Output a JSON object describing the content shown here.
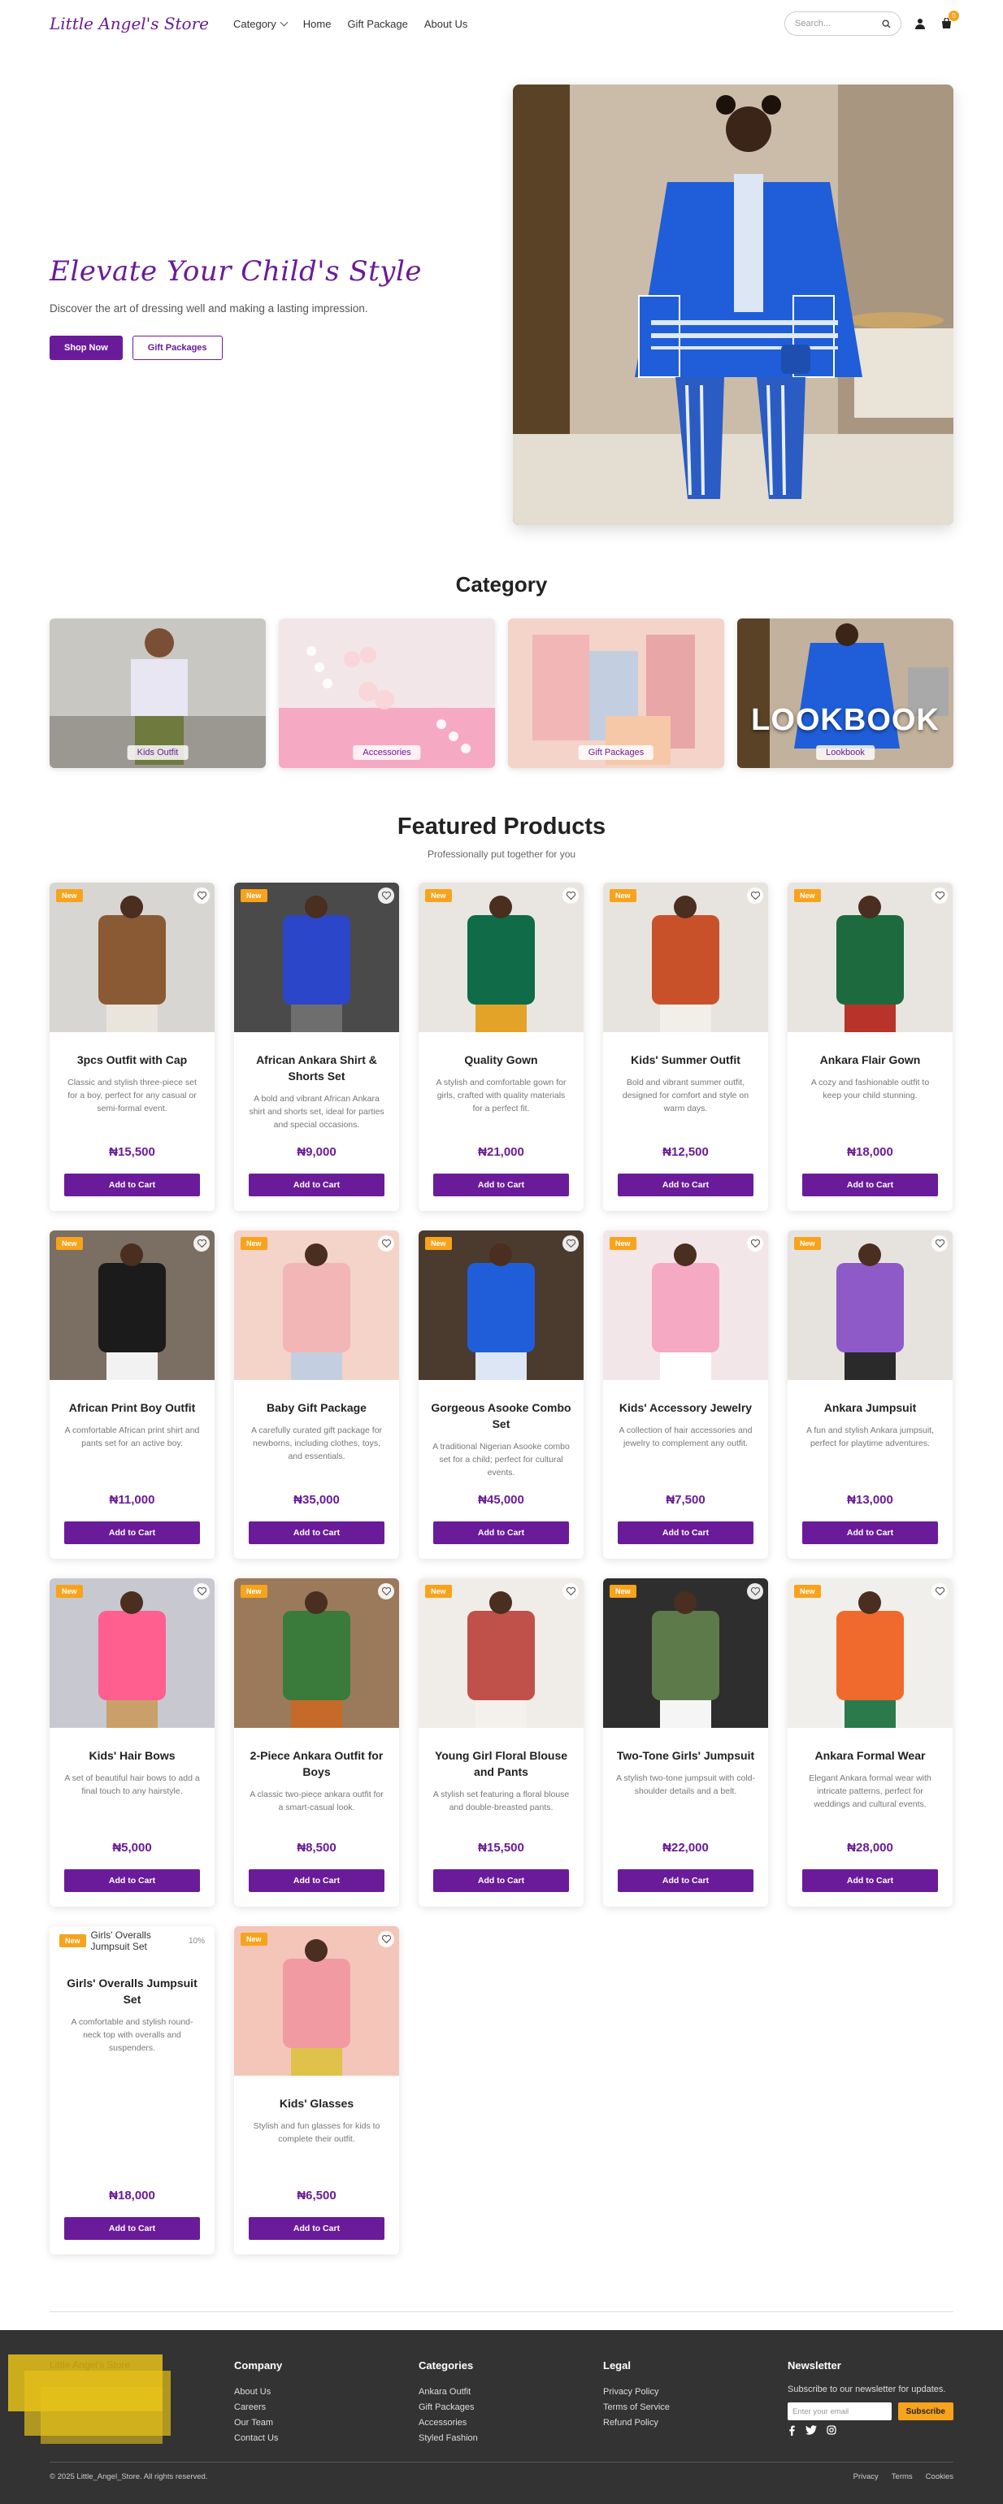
{
  "header": {
    "logo": "Little Angel's Store",
    "nav": [
      "Category",
      "Home",
      "Gift Package",
      "About Us"
    ],
    "search_placeholder": "Search...",
    "cart_count": "0"
  },
  "hero": {
    "title": "Elevate Your Child's Style",
    "subtitle": "Discover the art of dressing well and making a lasting impression.",
    "primary_button": "Shop Now",
    "secondary_button": "Gift Packages"
  },
  "category": {
    "title": "Category",
    "items": [
      {
        "label": "Kids Outfit"
      },
      {
        "label": "Accessories"
      },
      {
        "label": "Gift Packages"
      },
      {
        "label": "Lookbook",
        "overlay": "LOOKBOOK"
      }
    ]
  },
  "featured": {
    "title": "Featured Products",
    "subtitle": "Professionally put together for you",
    "badge": "New",
    "add_to_cart": "Add to Cart",
    "products": [
      {
        "name": "3pcs Outfit with Cap",
        "desc": "Classic and stylish three-piece set for a boy, perfect for any casual or semi-formal event.",
        "price": "₦15,500"
      },
      {
        "name": "African Ankara Shirt & Shorts Set",
        "desc": "A bold and vibrant African Ankara shirt and shorts set, ideal for parties and special occasions.",
        "price": "₦9,000"
      },
      {
        "name": "Quality Gown",
        "desc": "A stylish and comfortable gown for girls, crafted with quality materials for a perfect fit.",
        "price": "₦21,000"
      },
      {
        "name": "Kids' Summer Outfit",
        "desc": "Bold and vibrant summer outfit, designed for comfort and style on warm days.",
        "price": "₦12,500"
      },
      {
        "name": "Ankara Flair Gown",
        "desc": "A cozy and fashionable outfit to keep your child stunning.",
        "price": "₦18,000"
      },
      {
        "name": "African Print Boy Outfit",
        "desc": "A comfortable African print shirt and pants set for an active boy.",
        "price": "₦11,000"
      },
      {
        "name": "Baby Gift Package",
        "desc": "A carefully curated gift package for newborns, including clothes, toys, and essentials.",
        "price": "₦35,000"
      },
      {
        "name": "Gorgeous Asooke Combo Set",
        "desc": "A traditional Nigerian Asooke combo set for a child; perfect for cultural events.",
        "price": "₦45,000"
      },
      {
        "name": "Kids' Accessory Jewelry",
        "desc": "A collection of hair accessories and jewelry to complement any outfit.",
        "price": "₦7,500"
      },
      {
        "name": "Ankara Jumpsuit",
        "desc": "A fun and stylish Ankara jumpsuit, perfect for playtime adventures.",
        "price": "₦13,000"
      },
      {
        "name": "Kids' Hair Bows",
        "desc": "A set of beautiful hair bows to add a final touch to any hairstyle.",
        "price": "₦5,000"
      },
      {
        "name": "2-Piece Ankara Outfit for Boys",
        "desc": "A classic two-piece ankara outfit for a smart-casual look.",
        "price": "₦8,500"
      },
      {
        "name": "Young Girl Floral Blouse and Pants",
        "desc": "A stylish set featuring a floral blouse and double-breasted pants.",
        "price": "₦15,500"
      },
      {
        "name": "Two-Tone Girls' Jumpsuit",
        "desc": "A stylish two-tone jumpsuit with cold-shoulder details and a belt.",
        "price": "₦22,000"
      },
      {
        "name": "Ankara Formal Wear",
        "desc": "Elegant Ankara formal wear with intricate patterns, perfect for weddings and cultural events.",
        "price": "₦28,000"
      },
      {
        "name": "Girls' Overalls Jumpsuit Set",
        "desc": "A comfortable and stylish round-neck top with overalls and suspenders.",
        "price": "₦18,000",
        "broken_alt": "Girls' Overalls Jumpsuit Set",
        "broken_tag": "10%"
      },
      {
        "name": "Kids' Glasses",
        "desc": "Stylish and fun glasses for kids to complete their outfit.",
        "price": "₦6,500"
      }
    ]
  },
  "footer": {
    "brand": "Little Angel's Store",
    "columns": [
      {
        "title": "Company",
        "links": [
          "About Us",
          "Careers",
          "Our Team",
          "Contact Us"
        ]
      },
      {
        "title": "Categories",
        "links": [
          "Ankara Outfit",
          "Gift Packages",
          "Accessories",
          "Styled Fashion"
        ]
      },
      {
        "title": "Legal",
        "links": [
          "Privacy Policy",
          "Terms of Service",
          "Refund Policy"
        ]
      }
    ],
    "newsletter": {
      "title": "Newsletter",
      "subtitle": "Subscribe to our newsletter for updates.",
      "placeholder": "Enter your email",
      "button": "Subscribe"
    },
    "copyright": "© 2025 Little_Angel_Store. All rights reserved.",
    "bottom_links": [
      "Privacy",
      "Terms",
      "Cookies"
    ]
  },
  "colors": {
    "brand": "#6a1b9a",
    "accent": "#f7a31c",
    "footer_bg": "#333333"
  }
}
